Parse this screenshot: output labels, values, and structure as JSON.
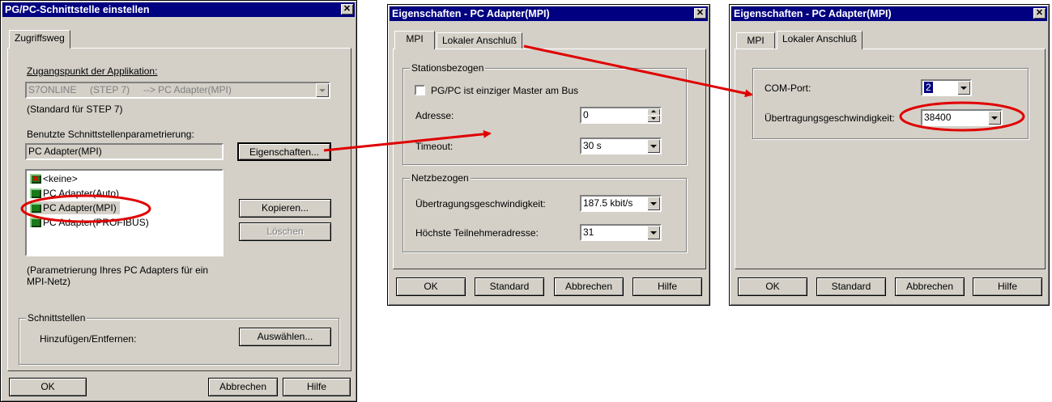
{
  "win1": {
    "title": "PG/PC-Schnittstelle einstellen",
    "tab": "Zugriffsweg",
    "access_point_label": "Zugangspunkt der Applikation:",
    "access_point_value": "S7ONLINE     (STEP 7)     --> PC Adapter(MPI)",
    "standard_note": "(Standard für STEP 7)",
    "param_label": "Benutzte Schnittstellenparametrierung:",
    "param_value": "PC Adapter(MPI)",
    "properties_btn": "Eigenschaften...",
    "list": [
      "<keine>",
      "PC Adapter(Auto)",
      "PC Adapter(MPI)",
      "PC Adapter(PROFIBUS)"
    ],
    "copy_btn": "Kopieren...",
    "delete_btn": "Löschen",
    "description": "(Parametrierung Ihres PC Adapters für ein MPI-Netz)",
    "interfaces_group": "Schnittstellen",
    "add_remove_label": "Hinzufügen/Entfernen:",
    "select_btn": "Auswählen...",
    "ok_btn": "OK",
    "cancel_btn": "Abbrechen",
    "help_btn": "Hilfe"
  },
  "win2": {
    "title": "Eigenschaften - PC Adapter(MPI)",
    "tab_mpi": "MPI",
    "tab_local": "Lokaler Anschluß",
    "station_group": "Stationsbezogen",
    "master_checkbox": "PG/PC ist einziger Master am Bus",
    "master_checked": false,
    "address_label": "Adresse:",
    "address_value": "0",
    "timeout_label": "Timeout:",
    "timeout_value": "30 s",
    "network_group": "Netzbezogen",
    "speed_label": "Übertragungsgeschwindigkeit:",
    "speed_value": "187.5 kbit/s",
    "highest_addr_label": "Höchste Teilnehmeradresse:",
    "highest_addr_value": "31",
    "ok_btn": "OK",
    "standard_btn": "Standard",
    "cancel_btn": "Abbrechen",
    "help_btn": "Hilfe"
  },
  "win3": {
    "title": "Eigenschaften - PC Adapter(MPI)",
    "tab_mpi": "MPI",
    "tab_local": "Lokaler Anschluß",
    "com_port_label": "COM-Port:",
    "com_port_value": "2",
    "speed_label": "Übertragungsgeschwindigkeit:",
    "speed_value": "38400",
    "ok_btn": "OK",
    "standard_btn": "Standard",
    "cancel_btn": "Abbrechen",
    "help_btn": "Hilfe"
  },
  "colors": {
    "titlebar": "#000080",
    "annotation": "#e00000",
    "face": "#d4d0c8"
  },
  "icons": {
    "close": "close-icon",
    "dropdown": "chevron-down-icon",
    "network": "network-adapter-icon"
  }
}
